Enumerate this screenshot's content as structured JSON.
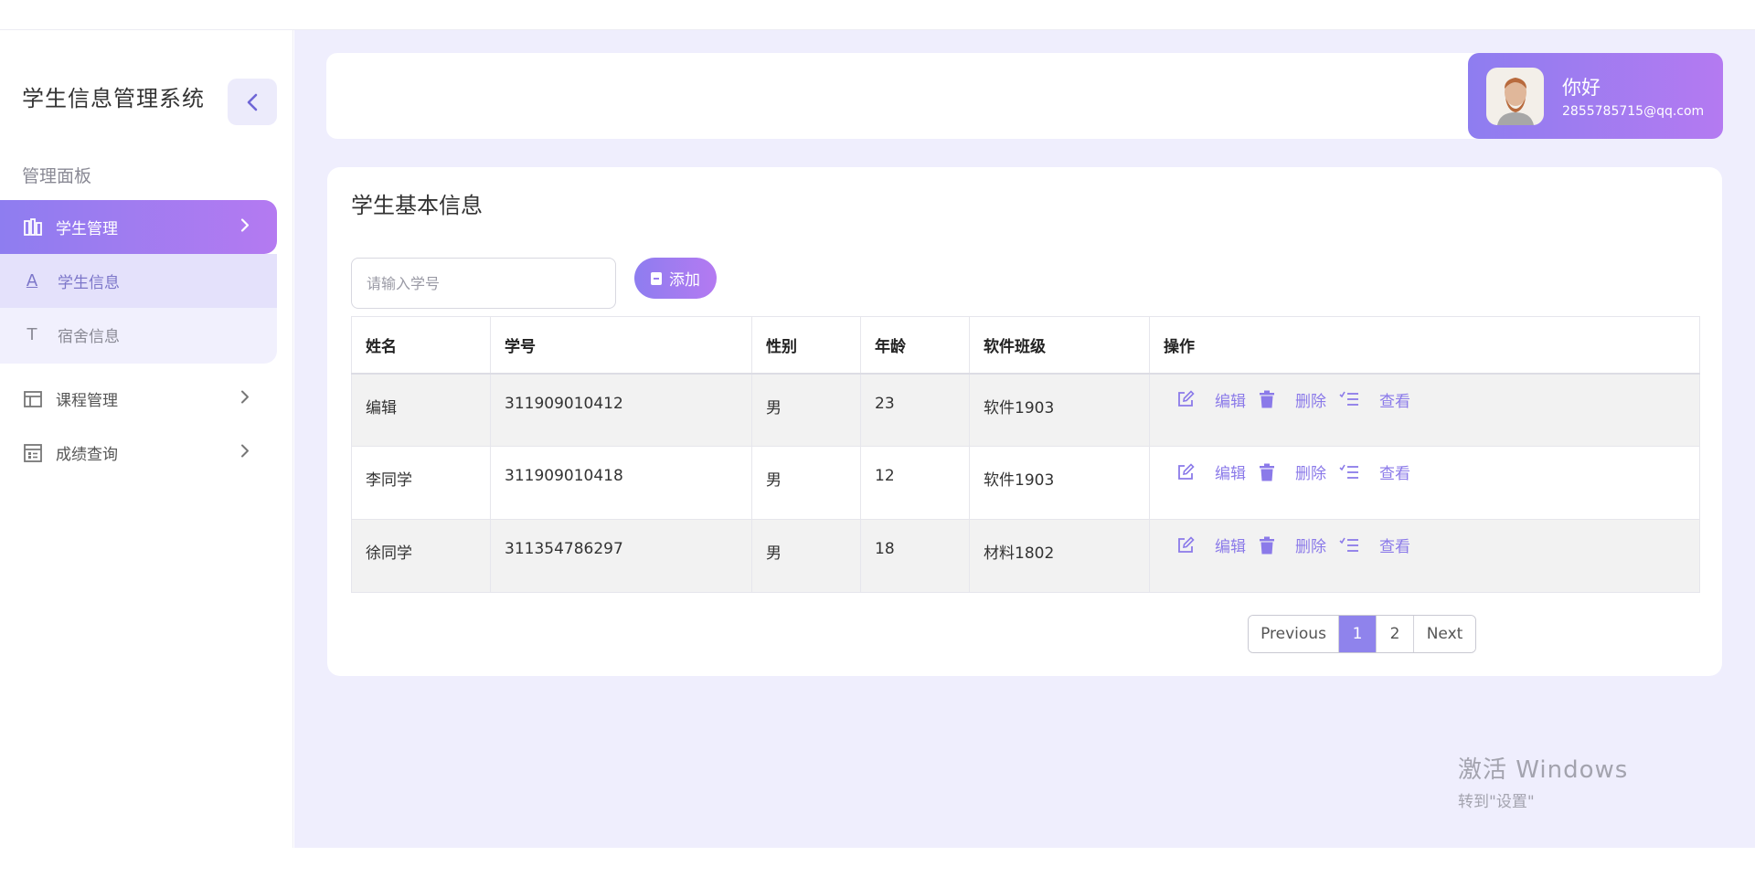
{
  "app": {
    "title": "学生信息管理系统"
  },
  "sidebar": {
    "section_label": "管理面板",
    "items": [
      {
        "label": "学生管理",
        "icon": "books-icon"
      },
      {
        "label": "课程管理",
        "icon": "table-icon"
      },
      {
        "label": "成绩查询",
        "icon": "report-icon"
      }
    ],
    "subitems": [
      {
        "label": "学生信息",
        "icon_text": "A"
      },
      {
        "label": "宿舍信息",
        "icon_text": "T"
      }
    ]
  },
  "user": {
    "greeting": "你好",
    "email": "2855785715@qq.com"
  },
  "main": {
    "title": "学生基本信息",
    "search": {
      "placeholder": "请输入学号",
      "value": ""
    },
    "add_label": "添加",
    "table": {
      "headers": [
        "姓名",
        "学号",
        "性别",
        "年龄",
        "软件班级",
        "操作"
      ],
      "rows": [
        [
          "编辑",
          "311909010412",
          "男",
          "23",
          "软件1903"
        ],
        [
          "李同学",
          "311909010418",
          "男",
          "12",
          "软件1903"
        ],
        [
          "徐同学",
          "311354786297",
          "男",
          "18",
          "材料1802"
        ]
      ],
      "actions": {
        "edit": "编辑",
        "delete": "删除",
        "view": "查看"
      }
    },
    "pagination": {
      "previous": "Previous",
      "pages": [
        "1",
        "2"
      ],
      "next": "Next",
      "current": "1"
    }
  },
  "watermark": {
    "line1": "激活 Windows",
    "line2": "转到\"设置\""
  },
  "colors": {
    "accent_start": "#8e7df0",
    "accent_end": "#b47af1",
    "background": "#efeefd",
    "action": "#8b7ae9"
  }
}
